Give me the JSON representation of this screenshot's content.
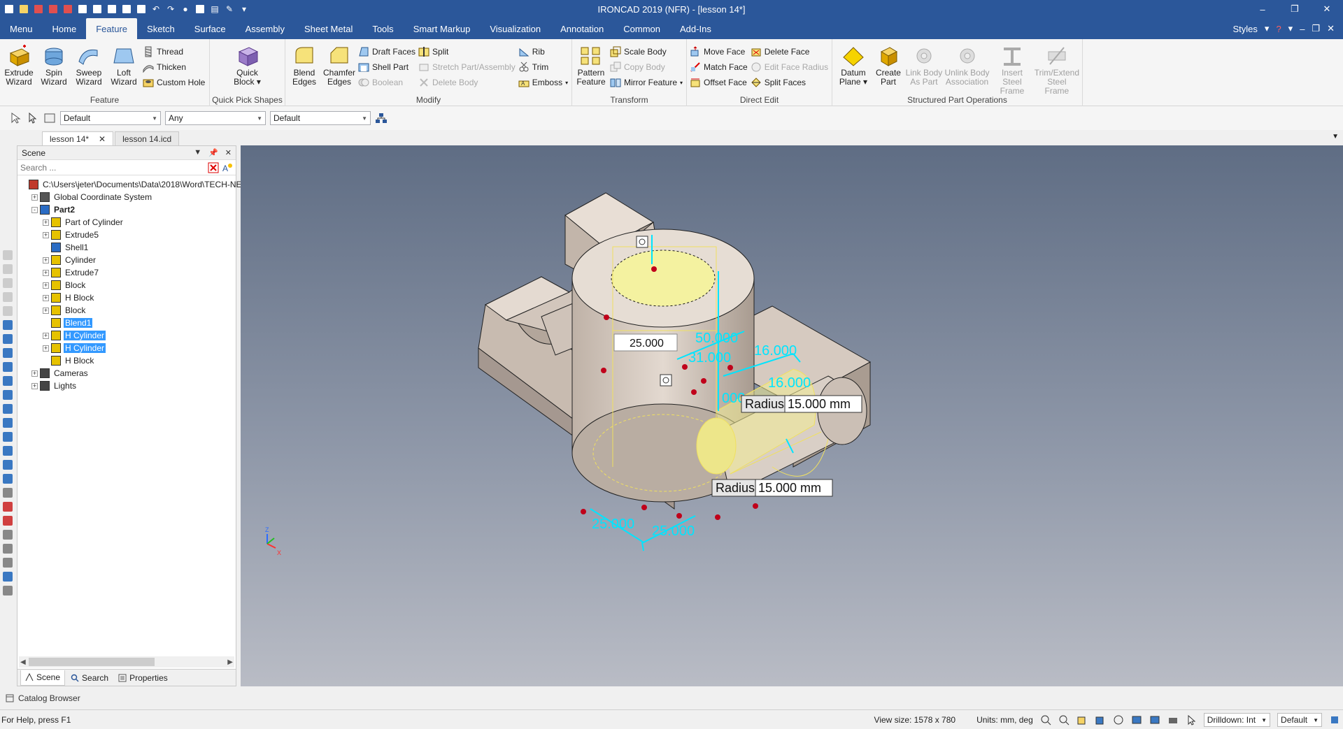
{
  "window": {
    "title": "IRONCAD 2019 (NFR) - [lesson 14*]",
    "controls": [
      "minimize-icon",
      "restore-icon",
      "close-icon"
    ]
  },
  "quick_access_icons": [
    "new-icon",
    "open-icon",
    "save-icon",
    "print-icon",
    "undo-icon",
    "redo-icon",
    "settings-icon"
  ],
  "ribbon_tabs": [
    "Menu",
    "Home",
    "Feature",
    "Sketch",
    "Surface",
    "Assembly",
    "Sheet Metal",
    "Tools",
    "Smart Markup",
    "Visualization",
    "Annotation",
    "Common",
    "Add-Ins"
  ],
  "active_tab": "Feature",
  "styles_label": "Styles",
  "ribbon": {
    "feature": {
      "label": "Feature",
      "big": [
        {
          "line1": "Extrude",
          "line2": "Wizard"
        },
        {
          "line1": "Spin",
          "line2": "Wizard"
        },
        {
          "line1": "Sweep",
          "line2": "Wizard"
        },
        {
          "line1": "Loft",
          "line2": "Wizard"
        }
      ],
      "small": [
        "Thread",
        "Thicken",
        "Custom Hole"
      ]
    },
    "quick_pick": {
      "label": "Quick Pick Shapes",
      "big": [
        {
          "line1": "Quick",
          "line2": "Block"
        }
      ]
    },
    "modify": {
      "label": "Modify",
      "big": [
        {
          "line1": "Blend",
          "line2": "Edges"
        },
        {
          "line1": "Chamfer",
          "line2": "Edges"
        }
      ],
      "col1": [
        "Draft Faces",
        "Shell Part",
        "Boolean"
      ],
      "col2": [
        "Split",
        "Stretch Part/Assembly",
        "Delete Body"
      ],
      "col3": [
        "Rib",
        "Trim",
        "Emboss"
      ]
    },
    "transform": {
      "label": "Transform",
      "big": [
        {
          "line1": "Pattern",
          "line2": "Feature"
        }
      ],
      "small": [
        "Scale Body",
        "Copy Body",
        "Mirror Feature"
      ]
    },
    "direct_edit": {
      "label": "Direct Edit",
      "col1": [
        "Move Face",
        "Match Face",
        "Offset Face"
      ],
      "col2": [
        "Delete Face",
        "Edit Face Radius",
        "Split Faces"
      ]
    },
    "structured": {
      "label": "Structured Part Operations",
      "big": [
        {
          "line1": "Datum",
          "line2": "Plane"
        },
        {
          "line1": "Create",
          "line2": "Part"
        },
        {
          "line1": "Link Body",
          "line2": "As Part"
        },
        {
          "line1": "Unlink Body",
          "line2": "Association"
        },
        {
          "line1": "Insert Steel",
          "line2": "Frame"
        },
        {
          "line1": "Trim/Extend",
          "line2": "Steel Frame"
        }
      ]
    }
  },
  "toolbar": {
    "combo1": "Default",
    "combo2": "Any",
    "combo3": "Default"
  },
  "doc_tabs": [
    "lesson 14*",
    "lesson 14.icd"
  ],
  "scene": {
    "title": "Scene",
    "search_placeholder": "Search ...",
    "tree": [
      {
        "label": "C:\\Users\\jeter\\Documents\\Data\\2018\\Word\\TECH-NE",
        "depth": 0,
        "expand": "",
        "icon": "#c0392b"
      },
      {
        "label": "Global Coordinate System",
        "depth": 1,
        "expand": "+",
        "icon": "#555555"
      },
      {
        "label": "Part2",
        "depth": 1,
        "expand": "-",
        "icon": "#2b6cc4",
        "bold": true
      },
      {
        "label": "Part of Cylinder",
        "depth": 2,
        "expand": "+",
        "icon": "#e6c200"
      },
      {
        "label": "Extrude5",
        "depth": 2,
        "expand": "+",
        "icon": "#e6c200"
      },
      {
        "label": "Shell1",
        "depth": 2,
        "expand": "",
        "icon": "#2b6cc4"
      },
      {
        "label": "Cylinder",
        "depth": 2,
        "expand": "+",
        "icon": "#e6c200"
      },
      {
        "label": "Extrude7",
        "depth": 2,
        "expand": "+",
        "icon": "#e6c200"
      },
      {
        "label": "Block",
        "depth": 2,
        "expand": "+",
        "icon": "#e6c200"
      },
      {
        "label": "H Block",
        "depth": 2,
        "expand": "+",
        "icon": "#e6c200"
      },
      {
        "label": "Block",
        "depth": 2,
        "expand": "+",
        "icon": "#e6c200"
      },
      {
        "label": "Blend1",
        "depth": 2,
        "expand": "",
        "icon": "#e6c200",
        "selected": true
      },
      {
        "label": "H Cylinder",
        "depth": 2,
        "expand": "+",
        "icon": "#e6c200",
        "selected": true
      },
      {
        "label": "H Cylinder",
        "depth": 2,
        "expand": "+",
        "icon": "#e6c200",
        "selected": true
      },
      {
        "label": "H Block",
        "depth": 2,
        "expand": "",
        "icon": "#e6c200"
      },
      {
        "label": "Cameras",
        "depth": 1,
        "expand": "+",
        "icon": "#444444"
      },
      {
        "label": "Lights",
        "depth": 1,
        "expand": "+",
        "icon": "#444444"
      }
    ],
    "bottom_tabs": [
      "Scene",
      "Search",
      "Properties"
    ]
  },
  "catalog_label": "Catalog Browser",
  "viewport": {
    "dims": {
      "d1": "25.000",
      "d2": "50.000",
      "d3": "31.000",
      "d4": "16.000",
      "d5": "16.000",
      "d6": "25.000",
      "d7": "25.000",
      "d8": "000"
    },
    "radius_label": "Radius",
    "radius1_value": "15.000 mm",
    "radius2_value": "15.000 mm",
    "triad": {
      "z": "Z",
      "x": "X"
    },
    "colors": {
      "dim": "#00e5ff",
      "body": "#d2c6bc",
      "highlight": "#f4f2a0"
    }
  },
  "status": {
    "help": "For Help, press F1",
    "view_size": "View size: 1578 x  780",
    "units": "Units: mm, deg",
    "drilldown": "Drilldown: Int",
    "style": "Default"
  }
}
